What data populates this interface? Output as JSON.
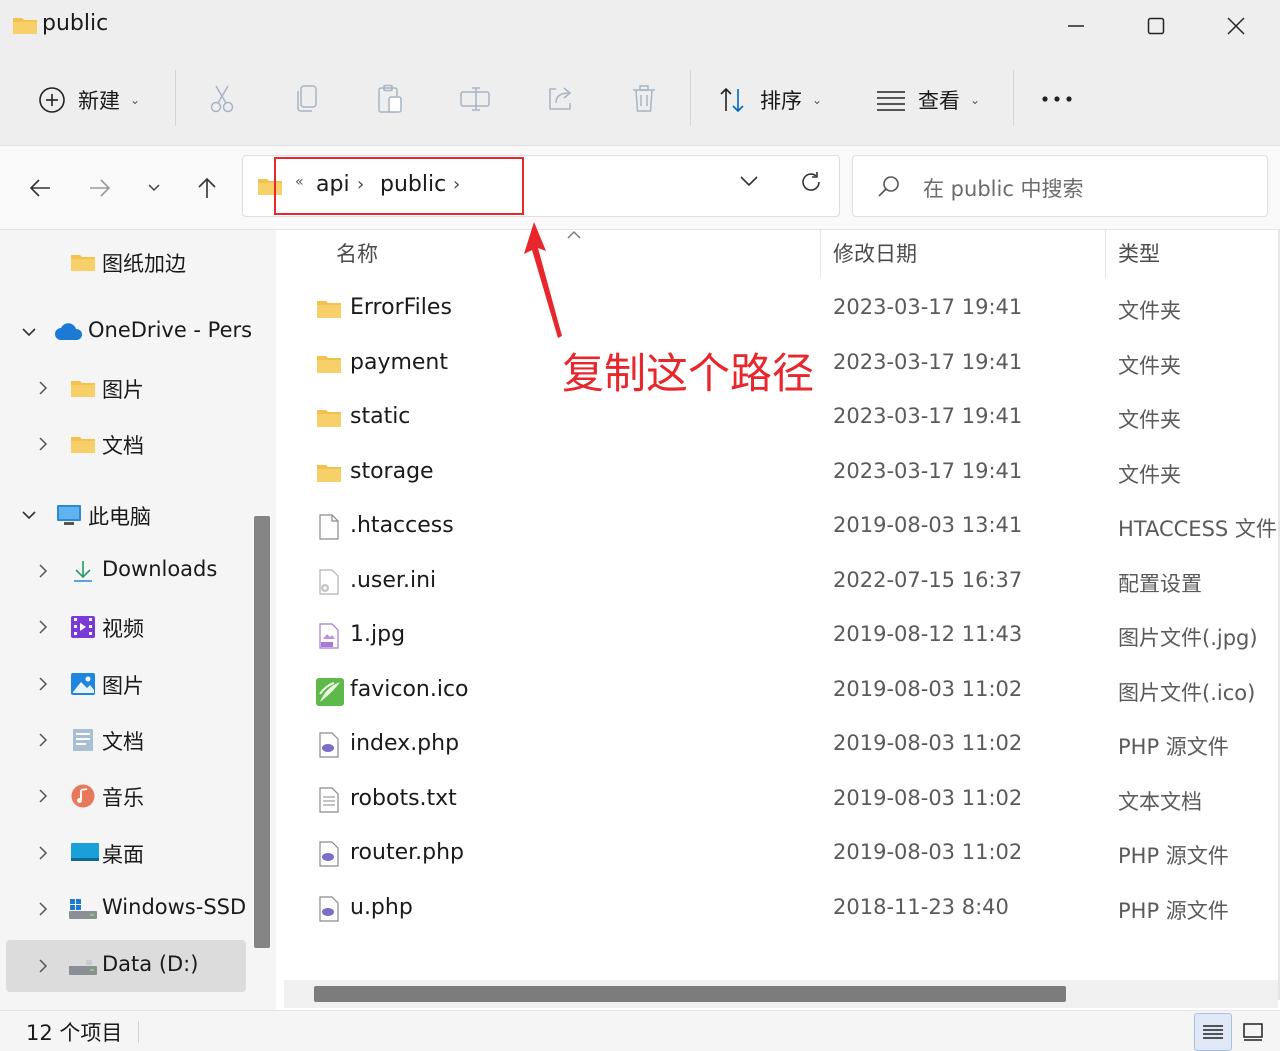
{
  "window": {
    "title": "public",
    "min_icon": "minimize-icon",
    "max_icon": "maximize-icon",
    "close_icon": "close-icon"
  },
  "toolbar": {
    "new_label": "新建",
    "sort_label": "排序",
    "view_label": "查看",
    "icons": [
      "plus-circle-icon",
      "cut-icon",
      "copy-icon",
      "paste-icon",
      "rename-icon",
      "share-icon",
      "delete-icon",
      "sort-icon",
      "view-icon",
      "more-icon"
    ]
  },
  "nav": {
    "breadcrumbs": [
      "api",
      "public"
    ],
    "overflow": "«",
    "search_placeholder": "在 public 中搜索"
  },
  "sidebar": {
    "items": [
      {
        "label": "图纸加边",
        "icon": "folder-icon"
      },
      {
        "label": "OneDrive - Pers",
        "icon": "onedrive-cloud-icon",
        "expanded": true
      },
      {
        "label": "图片",
        "icon": "folder-icon"
      },
      {
        "label": "文档",
        "icon": "folder-icon"
      },
      {
        "label": "此电脑",
        "icon": "monitor-icon",
        "expanded": true
      },
      {
        "label": "Downloads",
        "icon": "download-arrow-icon"
      },
      {
        "label": "视频",
        "icon": "video-icon"
      },
      {
        "label": "图片",
        "icon": "pictures-icon"
      },
      {
        "label": "文档",
        "icon": "documents-icon"
      },
      {
        "label": "音乐",
        "icon": "music-icon"
      },
      {
        "label": "桌面",
        "icon": "desktop-icon"
      },
      {
        "label": "Windows-SSD",
        "icon": "drive-windows-icon"
      },
      {
        "label": "Data (D:)",
        "icon": "drive-icon",
        "selected": true
      }
    ]
  },
  "columns": {
    "name": "名称",
    "date": "修改日期",
    "type": "类型"
  },
  "files": [
    {
      "name": "ErrorFiles",
      "date": "2023-03-17 19:41",
      "type": "文件夹",
      "icon": "folder-icon"
    },
    {
      "name": "payment",
      "date": "2023-03-17 19:41",
      "type": "文件夹",
      "icon": "folder-icon"
    },
    {
      "name": "static",
      "date": "2023-03-17 19:41",
      "type": "文件夹",
      "icon": "folder-icon"
    },
    {
      "name": "storage",
      "date": "2023-03-17 19:41",
      "type": "文件夹",
      "icon": "folder-icon"
    },
    {
      "name": ".htaccess",
      "date": "2019-08-03 13:41",
      "type": "HTACCESS 文件",
      "icon": "file-icon"
    },
    {
      "name": ".user.ini",
      "date": "2022-07-15 16:37",
      "type": "配置设置",
      "icon": "config-file-icon"
    },
    {
      "name": "1.jpg",
      "date": "2019-08-12 11:43",
      "type": "图片文件(.jpg)",
      "icon": "jpg-file-icon"
    },
    {
      "name": "favicon.ico",
      "date": "2019-08-03 11:02",
      "type": "图片文件(.ico)",
      "icon": "ico-file-icon"
    },
    {
      "name": "index.php",
      "date": "2019-08-03 11:02",
      "type": "PHP 源文件",
      "icon": "php-file-icon"
    },
    {
      "name": "robots.txt",
      "date": "2019-08-03 11:02",
      "type": "文本文档",
      "icon": "text-file-icon"
    },
    {
      "name": "router.php",
      "date": "2019-08-03 11:02",
      "type": "PHP 源文件",
      "icon": "php-file-icon"
    },
    {
      "name": "u.php",
      "date": "2018-11-23 8:40",
      "type": "PHP 源文件",
      "icon": "php-file-icon"
    }
  ],
  "annotation": {
    "text": "复制这个路径",
    "color": "#e8262b"
  },
  "status": {
    "count_text": "12 个项目"
  },
  "colors": {
    "folder": "#f3c14d",
    "accent": "#0067c0",
    "annotation": "#e8262b"
  }
}
